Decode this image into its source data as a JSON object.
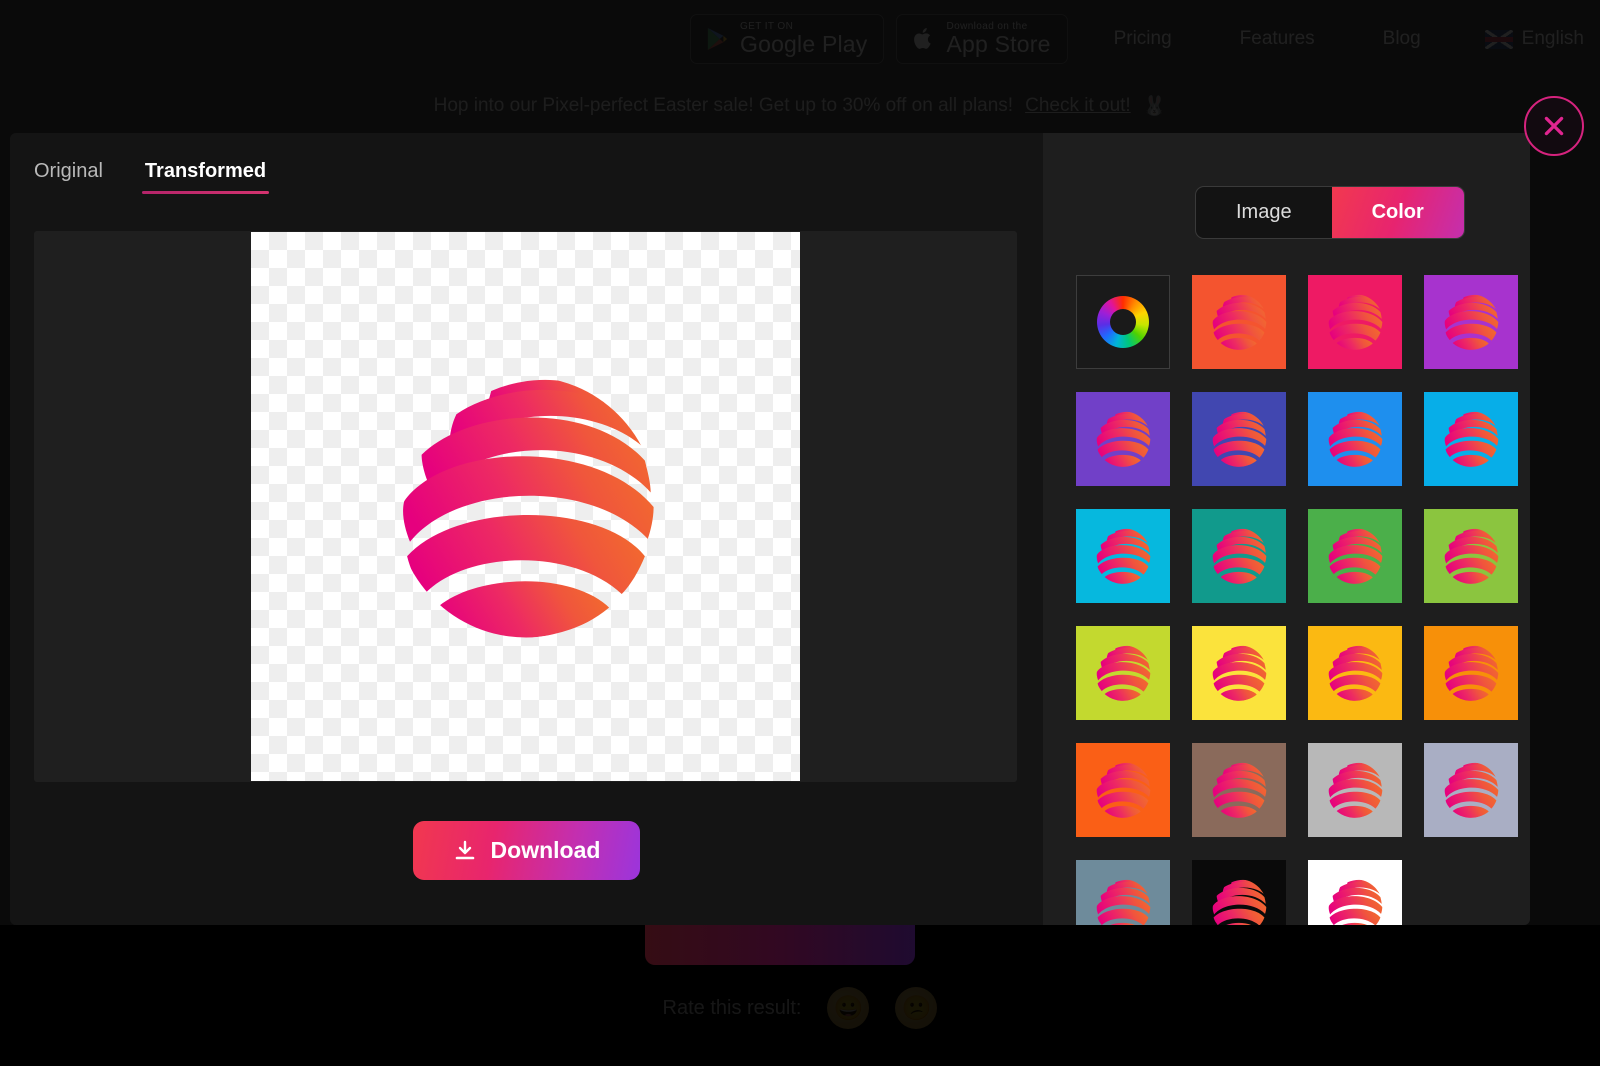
{
  "header": {
    "store_badges": [
      {
        "icon": "google-play-icon",
        "small": "GET IT ON",
        "big": "Google Play"
      },
      {
        "icon": "apple-icon",
        "small": "Download on the",
        "big": "App Store"
      }
    ],
    "nav": [
      {
        "label": "Pricing"
      },
      {
        "label": "Features"
      },
      {
        "label": "Blog"
      }
    ],
    "language": {
      "label": "English",
      "icon": "uk-flag-icon"
    }
  },
  "promo": {
    "text": "Hop into our Pixel-perfect Easter sale! Get up to 30% off on all plans!",
    "link": "Check it out!",
    "emoji": "🐰"
  },
  "modal": {
    "close_icon": "close-icon",
    "tabs": [
      {
        "label": "Original",
        "active": false
      },
      {
        "label": "Transformed",
        "active": true
      }
    ],
    "preview": {
      "image_name": "striped-globe-logo",
      "background": "transparent-checkerboard"
    },
    "download": {
      "label": "Download",
      "icon": "download-icon"
    },
    "segmented": [
      {
        "label": "Image",
        "active": false
      },
      {
        "label": "Color",
        "active": true
      }
    ],
    "swatches": [
      {
        "name": "custom-color-wheel",
        "color": "wheel"
      },
      {
        "name": "swatch-orange-red",
        "color": "#F4542F"
      },
      {
        "name": "swatch-pink",
        "color": "#EE1A64"
      },
      {
        "name": "swatch-purple-magenta",
        "color": "#A733CE"
      },
      {
        "name": "swatch-purple",
        "color": "#7140C8"
      },
      {
        "name": "swatch-indigo",
        "color": "#4147B0"
      },
      {
        "name": "swatch-blue",
        "color": "#1E8FEE"
      },
      {
        "name": "swatch-light-blue",
        "color": "#07AEE8"
      },
      {
        "name": "swatch-cyan",
        "color": "#06B8DE"
      },
      {
        "name": "swatch-teal",
        "color": "#119A8C"
      },
      {
        "name": "swatch-green",
        "color": "#4BAF4A"
      },
      {
        "name": "swatch-yellow-green",
        "color": "#8BC53F"
      },
      {
        "name": "swatch-lime",
        "color": "#C3D92F"
      },
      {
        "name": "swatch-yellow",
        "color": "#FBE33C"
      },
      {
        "name": "swatch-amber",
        "color": "#FBB912"
      },
      {
        "name": "swatch-orange",
        "color": "#F79009"
      },
      {
        "name": "swatch-bright-orange",
        "color": "#FA5F16"
      },
      {
        "name": "swatch-brown",
        "color": "#8A6A5B"
      },
      {
        "name": "swatch-light-gray",
        "color": "#B8B8B8"
      },
      {
        "name": "swatch-blue-gray",
        "color": "#A9AEC4"
      },
      {
        "name": "swatch-slate",
        "color": "#6E8B9B"
      },
      {
        "name": "swatch-black",
        "color": "#0A0A0A"
      },
      {
        "name": "swatch-white",
        "color": "#FFFFFF"
      }
    ]
  },
  "footer": {
    "rate_label": "Rate this result:",
    "emojis": [
      "😀",
      "😕"
    ]
  },
  "colors": {
    "accent_pink": "#E7246F",
    "accent_purple": "#9B35DC",
    "accent_red": "#F2394F",
    "modal_bg": "#141414",
    "panel_bg": "#1E1E1E",
    "preview_bg": "#1F1F1F"
  }
}
